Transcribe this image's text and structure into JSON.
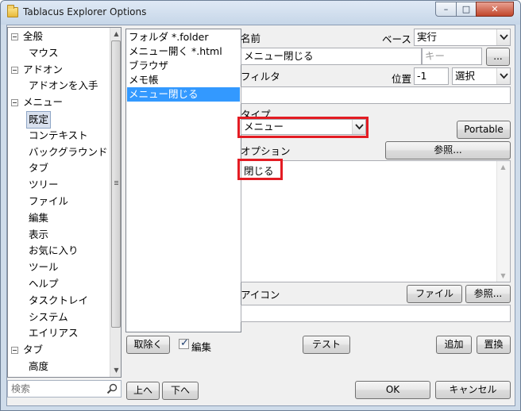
{
  "window": {
    "title": "Tablacus Explorer Options",
    "controls": {
      "minimize": "–",
      "maximize": "□",
      "close": "✕"
    }
  },
  "tree": {
    "items": [
      {
        "label": "全般",
        "level": 0,
        "expander": true
      },
      {
        "label": "マウス",
        "level": 1
      },
      {
        "label": "アドオン",
        "level": 0,
        "expander": true
      },
      {
        "label": "アドオンを入手",
        "level": 1
      },
      {
        "label": "メニュー",
        "level": 0,
        "expander": true
      },
      {
        "label": "既定",
        "level": 1,
        "selected": true
      },
      {
        "label": "コンテキスト",
        "level": 1
      },
      {
        "label": "バックグラウンド",
        "level": 1
      },
      {
        "label": "タブ",
        "level": 1
      },
      {
        "label": "ツリー",
        "level": 1
      },
      {
        "label": "ファイル",
        "level": 1
      },
      {
        "label": "編集",
        "level": 1
      },
      {
        "label": "表示",
        "level": 1
      },
      {
        "label": "お気に入り",
        "level": 1
      },
      {
        "label": "ツール",
        "level": 1
      },
      {
        "label": "ヘルプ",
        "level": 1
      },
      {
        "label": "タスクトレイ",
        "level": 1
      },
      {
        "label": "システム",
        "level": 1
      },
      {
        "label": "エイリアス",
        "level": 1
      },
      {
        "label": "タブ",
        "level": 0,
        "expander": true
      },
      {
        "label": "高度",
        "level": 1
      }
    ],
    "search_placeholder": "検索"
  },
  "menu_list": {
    "items": [
      {
        "label": "フォルダ *.folder"
      },
      {
        "label": "メニュー開く *.html"
      },
      {
        "label": "ブラウザ"
      },
      {
        "label": "メモ帳"
      },
      {
        "label": "メニュー閉じる",
        "selected": true
      }
    ],
    "remove_label": "取除く",
    "edit_label": "編集",
    "edit_checked": true
  },
  "form": {
    "name_label": "名前",
    "name_value": "メニュー閉じる",
    "key_placeholder": "キー",
    "base_label": "ベース",
    "base_value": "実行",
    "browse_dots": "...",
    "filter_label": "フィルタ",
    "filter_value": "",
    "position_label": "位置",
    "position_value": "-1",
    "select_value": "選択",
    "type_label": "タイプ",
    "type_value": "メニュー",
    "portable_label": "Portable",
    "option_label": "オプション",
    "browse_label": "参照...",
    "option_value": "閉じる",
    "icon_label": "アイコン",
    "icon_value": "",
    "file_label": "ファイル",
    "browse2_label": "参照..."
  },
  "actions": {
    "test_label": "テスト",
    "add_label": "追加",
    "replace_label": "置換",
    "up_label": "上へ",
    "down_label": "下へ",
    "ok_label": "OK",
    "cancel_label": "キャンセル"
  },
  "colors": {
    "selection": "#3399ff",
    "highlight_box": "#e31c23",
    "window_frame": "#cfdcea"
  }
}
